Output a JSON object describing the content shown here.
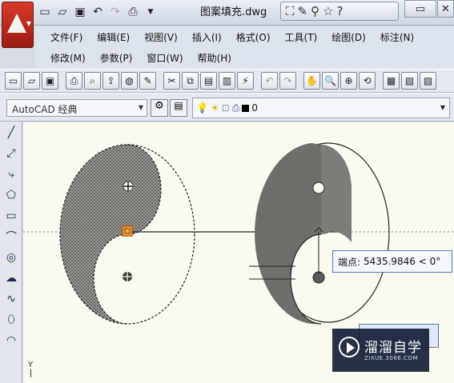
{
  "title_bar": {
    "document_title": "图案填充.dwg",
    "quick_access_icons": [
      "new-icon",
      "open-icon",
      "save-icon",
      "undo-icon",
      "redo-icon",
      "print-icon"
    ],
    "search_icons": [
      "binoculars-icon",
      "wrench-icon",
      "sign-in-icon",
      "star-icon",
      "help-icon"
    ]
  },
  "menu": {
    "row1": [
      "文件(F)",
      "编辑(E)",
      "视图(V)",
      "插入(I)",
      "格式(O)",
      "工具(T)",
      "绘图(D)",
      "标注(N)"
    ],
    "row2": [
      "修改(M)",
      "参数(P)",
      "窗口(W)",
      "帮助(H)"
    ]
  },
  "toolbar": {
    "workspace_value": "AutoCAD 经典",
    "layer_value": "0"
  },
  "canvas": {
    "tooltip_label": "端点:",
    "tooltip_value": "5435.9846 < 0°",
    "ucs_label": "Y"
  },
  "watermark": {
    "brand": "溜溜自学",
    "url": "ZIXUE.3066.COM"
  },
  "colors": {
    "canvas_bg": "#fbfaf0",
    "fill_gray": "#6e6e6a",
    "accent": "#d06a00"
  }
}
